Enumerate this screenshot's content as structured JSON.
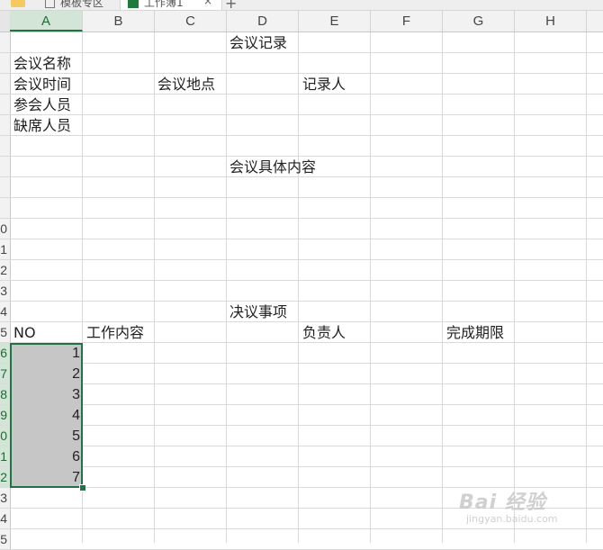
{
  "tabs": {
    "template_tab": "模板专区",
    "workbook_tab": "工作簿1",
    "close_glyph": "×",
    "new_tab_glyph": "+"
  },
  "columns": [
    "A",
    "B",
    "C",
    "D",
    "E",
    "F",
    "G",
    "H"
  ],
  "row_headers": [
    "",
    "",
    "",
    "",
    "",
    "",
    "",
    "",
    "",
    "0",
    "1",
    "2",
    "3",
    "4",
    "5",
    "6",
    "7",
    "8",
    "9",
    "0",
    "1",
    "2",
    "3",
    "4",
    "5"
  ],
  "cells": {
    "title": "会议记录",
    "meeting_name": "会议名称",
    "meeting_time": "会议时间",
    "meeting_place": "会议地点",
    "recorder": "记录人",
    "attendees": "参会人员",
    "absentees": "缺席人员",
    "content_heading": "会议具体内容",
    "resolution_heading": "决议事项",
    "col_no": "NO",
    "col_work": "工作内容",
    "col_owner": "负责人",
    "col_deadline": "完成期限"
  },
  "numbers": [
    "1",
    "2",
    "3",
    "4",
    "5",
    "6",
    "7"
  ],
  "watermark": {
    "main": "Bai 经验",
    "sub": "jingyan.baidu.com"
  },
  "colors": {
    "excel_green": "#217346",
    "selection_fill": "#c6c6c6",
    "header_bg": "#f2f2f2"
  }
}
